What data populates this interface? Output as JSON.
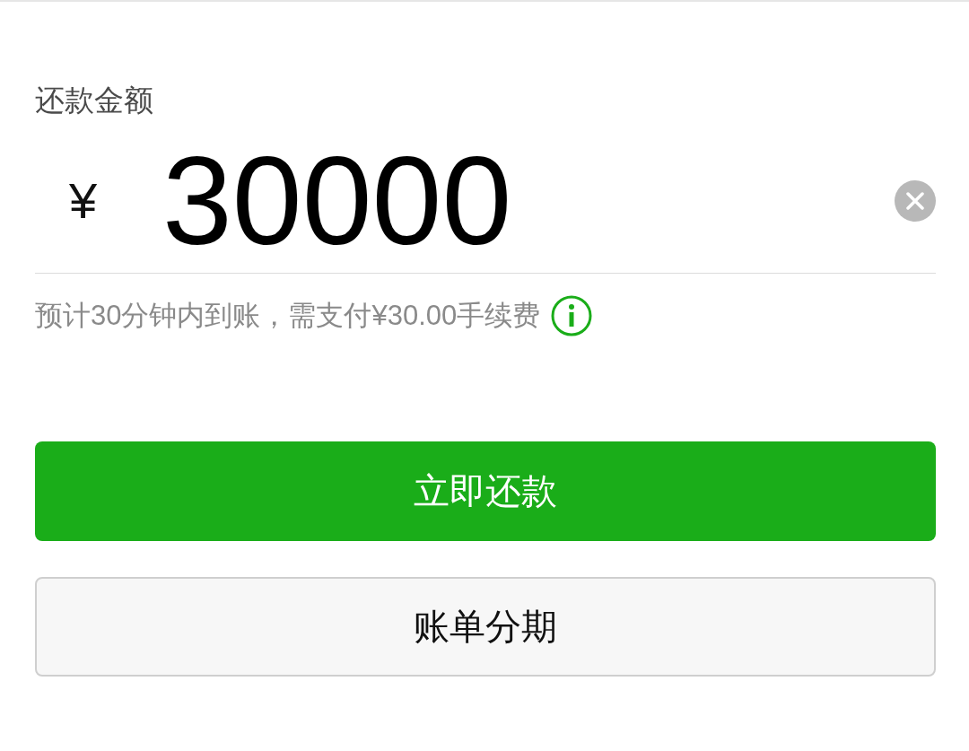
{
  "label": "还款金额",
  "amount": {
    "currency": "¥",
    "value": "30000"
  },
  "note": "预计30分钟内到账，需支付¥30.00手续费",
  "buttons": [
    {
      "label": "立即还款",
      "kind": "primary"
    },
    {
      "label": "账单分期",
      "kind": "secondary"
    }
  ]
}
